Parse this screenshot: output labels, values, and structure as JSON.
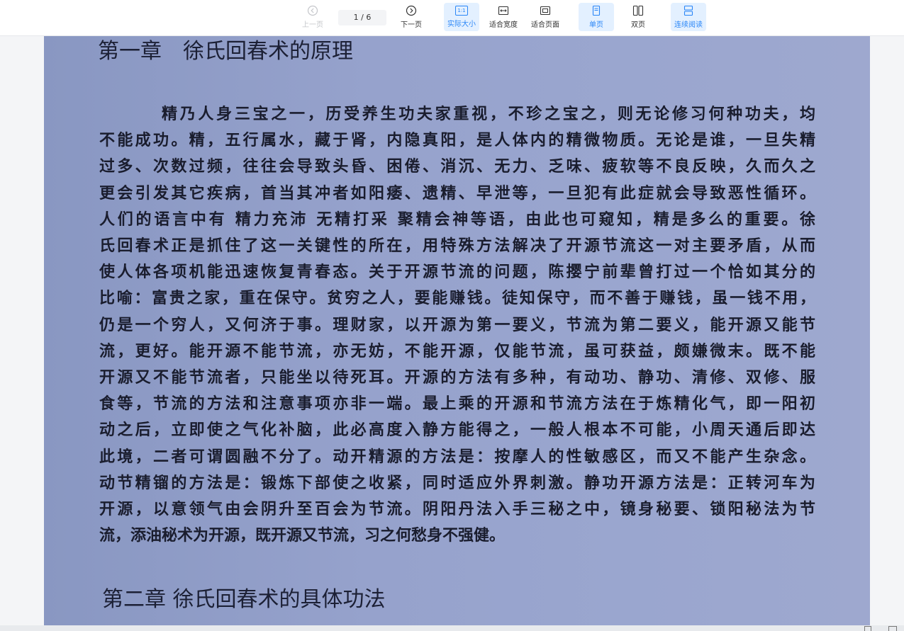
{
  "toolbar": {
    "prev_label": "上一页",
    "page_indicator": "1 / 6",
    "next_label": "下一页",
    "actual_size_label": "实际大小",
    "actual_size_icon_text": "1:1",
    "fit_width_label": "适合宽度",
    "fit_page_label": "适合页面",
    "single_page_label": "单页",
    "double_page_label": "双页",
    "continuous_label": "连续阅读"
  },
  "document": {
    "chapter1_title": "第一章　徐氏回春术的原理",
    "paragraph_lines": [
      "精乃人身三宝之一，历受养生功夫家重视，不珍之宝之，则无论修习何种功夫，均",
      "不能成功。精，五行属水，藏于肾，内隐真阳，是人体内的精微物质。无论是谁，一旦失精",
      "过多、次数过频，往往会导致头昏、困倦、消沉、无力、乏味、疲软等不良反映，久而久之",
      "更会引发其它疾病，首当其冲者如阳痿、遗精、早泄等，一旦犯有此症就会导致恶性循环。",
      "人们的语言中有 精力充沛 无精打采 聚精会神等语，由此也可窥知，精是多么的重要。徐",
      "氏回春术正是抓住了这一关键性的所在，用特殊方法解决了开源节流这一对主要矛盾，从而",
      "使人体各项机能迅速恢复青春态。关于开源节流的问题，陈撄宁前辈曾打过一个恰如其分的",
      "比喻：富贵之家，重在保守。贫穷之人，要能赚钱。徒知保守，而不善于赚钱，虽一钱不用，",
      "仍是一个穷人，又何济于事。理财家，以开源为第一要义，节流为第二要义，能开源又能节",
      "流，更好。能开源不能节流，亦无妨，不能开源，仅能节流，虽可获益，颇嫌微末。既不能",
      "开源又不能节流者，只能坐以待死耳。开源的方法有多种，有动功、静功、清修、双修、服",
      "食等，节流的方法和注意事项亦非一端。最上乘的开源和节流方法在于炼精化气，即一阳初",
      "动之后，立即使之气化补脑，此必高度入静方能得之，一般人根本不可能，小周天通后即达",
      "此境，二者可谓圆融不分了。动开精源的方法是：按摩人的性敏感区，而又不能产生杂念。",
      "动节精镏的方法是：锻炼下部使之收紧，同时适应外界刺激。静功开源方法是：正转河车为",
      "开源，以意领气由会阴升至百会为节流。阴阳丹法入手三秘之中，镜身秘要、锁阳秘法为节",
      "流，添油秘术为开源，既开源又节流，习之何愁身不强健。"
    ],
    "chapter2_title": "第二章 徐氏回春术的具体功法"
  },
  "colors": {
    "accent": "#2a86f7",
    "active_bg": "#e3f0ff",
    "page_bg": "#96a2cc"
  }
}
